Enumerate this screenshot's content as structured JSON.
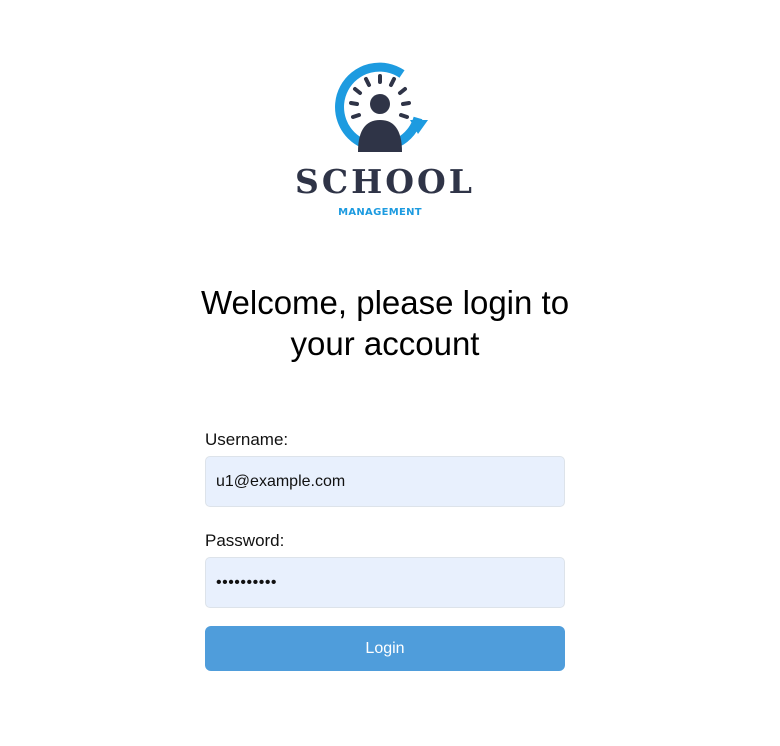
{
  "logo": {
    "wordmark": "SCHOOL",
    "tagline": "MANAGEMENT",
    "icon": "school-clock-person-icon",
    "colors": {
      "dark": "#2f3447",
      "accent": "#1d9be0"
    }
  },
  "heading": {
    "text": "Welcome, please login to your account"
  },
  "form": {
    "username_label": "Username:",
    "username_value": "u1@example.com",
    "password_label": "Password:",
    "password_value": "••••••••••",
    "login_label": "Login"
  },
  "colors": {
    "input_bg": "#e8f0fd",
    "button_bg": "#4f9ddb",
    "button_text": "#ffffff"
  }
}
